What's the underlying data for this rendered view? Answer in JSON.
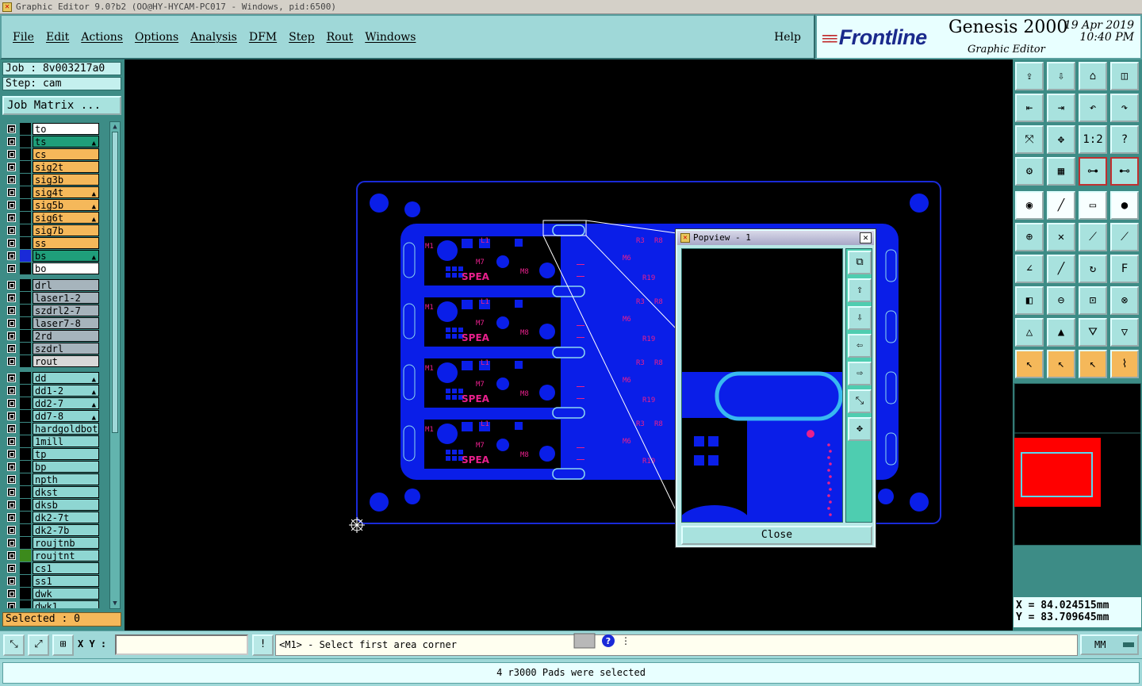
{
  "window": {
    "title": "Graphic Editor 9.0?b2 (OO@HY-HYCAM-PC017 - Windows, pid:6500)"
  },
  "menu": {
    "items": [
      "File",
      "Edit",
      "Actions",
      "Options",
      "Analysis",
      "DFM",
      "Step",
      "Rout",
      "Windows"
    ],
    "help": "Help"
  },
  "brand": {
    "logo": "Frontline",
    "product": "Genesis 2000",
    "subtitle": "Graphic Editor",
    "date": "19 Apr 2019",
    "time": "10:40 PM"
  },
  "job": {
    "job_label": "Job : 8v003217a0",
    "step_label": "Step: cam",
    "matrix_button": "Job Matrix ..."
  },
  "layers": [
    {
      "name": "to",
      "color": "#ffffff",
      "flame": false,
      "sel": ""
    },
    {
      "name": "ts",
      "color": "#1f9e7a",
      "flame": true,
      "sel": ""
    },
    {
      "name": "cs",
      "color": "#f5b85a",
      "flame": false,
      "sel": ""
    },
    {
      "name": "sig2t",
      "color": "#f5b85a",
      "flame": false,
      "sel": ""
    },
    {
      "name": "sig3b",
      "color": "#f5b85a",
      "flame": false,
      "sel": ""
    },
    {
      "name": "sig4t",
      "color": "#f5b85a",
      "flame": true,
      "sel": ""
    },
    {
      "name": "sig5b",
      "color": "#f5b85a",
      "flame": true,
      "sel": ""
    },
    {
      "name": "sig6t",
      "color": "#f5b85a",
      "flame": true,
      "sel": ""
    },
    {
      "name": "sig7b",
      "color": "#f5b85a",
      "flame": false,
      "sel": ""
    },
    {
      "name": "ss",
      "color": "#f5b85a",
      "flame": false,
      "sel": ""
    },
    {
      "name": "bs",
      "color": "#1f9e7a",
      "flame": true,
      "sel": "#1a2ad8"
    },
    {
      "name": "bo",
      "color": "#ffffff",
      "flame": false,
      "sel": ""
    },
    {
      "name": "drl",
      "color": "#a6b4bc",
      "flame": false,
      "sel": "",
      "gap": true
    },
    {
      "name": "laser1-2",
      "color": "#a6b4bc",
      "flame": false,
      "sel": ""
    },
    {
      "name": "szdrl2-7",
      "color": "#a6b4bc",
      "flame": false,
      "sel": ""
    },
    {
      "name": "laser7-8",
      "color": "#a6b4bc",
      "flame": false,
      "sel": ""
    },
    {
      "name": "2rd",
      "color": "#a6b4bc",
      "flame": false,
      "sel": ""
    },
    {
      "name": "szdrl",
      "color": "#a6b4bc",
      "flame": false,
      "sel": ""
    },
    {
      "name": "rout",
      "color": "#d8d8d8",
      "flame": false,
      "sel": ""
    },
    {
      "name": "dd",
      "color": "#8ed6d2",
      "flame": true,
      "sel": "",
      "gap": true
    },
    {
      "name": "dd1-2",
      "color": "#8ed6d2",
      "flame": true,
      "sel": ""
    },
    {
      "name": "dd2-7",
      "color": "#8ed6d2",
      "flame": true,
      "sel": ""
    },
    {
      "name": "dd7-8",
      "color": "#8ed6d2",
      "flame": true,
      "sel": ""
    },
    {
      "name": "hardgoldbott",
      "color": "#8ed6d2",
      "flame": false,
      "sel": ""
    },
    {
      "name": "1mill",
      "color": "#8ed6d2",
      "flame": false,
      "sel": ""
    },
    {
      "name": "tp",
      "color": "#8ed6d2",
      "flame": false,
      "sel": ""
    },
    {
      "name": "bp",
      "color": "#8ed6d2",
      "flame": false,
      "sel": ""
    },
    {
      "name": "npth",
      "color": "#8ed6d2",
      "flame": false,
      "sel": ""
    },
    {
      "name": "dkst",
      "color": "#8ed6d2",
      "flame": false,
      "sel": ""
    },
    {
      "name": "dksb",
      "color": "#8ed6d2",
      "flame": false,
      "sel": ""
    },
    {
      "name": "dk2-7t",
      "color": "#8ed6d2",
      "flame": false,
      "sel": ""
    },
    {
      "name": "dk2-7b",
      "color": "#8ed6d2",
      "flame": false,
      "sel": ""
    },
    {
      "name": "roujtnb",
      "color": "#8ed6d2",
      "flame": false,
      "sel": ""
    },
    {
      "name": "roujtnt",
      "color": "#8ed6d2",
      "flame": false,
      "sel": "#3c8a1c"
    },
    {
      "name": "cs1",
      "color": "#8ed6d2",
      "flame": false,
      "sel": ""
    },
    {
      "name": "ss1",
      "color": "#8ed6d2",
      "flame": false,
      "sel": ""
    },
    {
      "name": "dwk",
      "color": "#8ed6d2",
      "flame": false,
      "sel": ""
    },
    {
      "name": "dwk1",
      "color": "#8ed6d2",
      "flame": false,
      "sel": ""
    }
  ],
  "selected": "Selected : 0",
  "popview": {
    "title": "Popview - 1",
    "close_button": "Close"
  },
  "coords": {
    "x": "X = 84.024515mm",
    "y": "Y = 83.709645mm"
  },
  "status": {
    "xy_label": "X Y :",
    "xy_value": "",
    "prompt": "<M1> - Select first area corner",
    "units": "MM",
    "message": "4 r3000 Pads were selected"
  },
  "pcb_labels": {
    "silk": "SPEA",
    "refs": [
      "R3",
      "R8",
      "R19",
      "R1",
      "M1",
      "L1",
      "M7",
      "M8",
      "M6",
      "R9"
    ]
  },
  "colors": {
    "board": "#0a1ee8",
    "silk": "#e8208c",
    "outline": "#1a2ad8",
    "highlight": "#8ed6f0"
  }
}
